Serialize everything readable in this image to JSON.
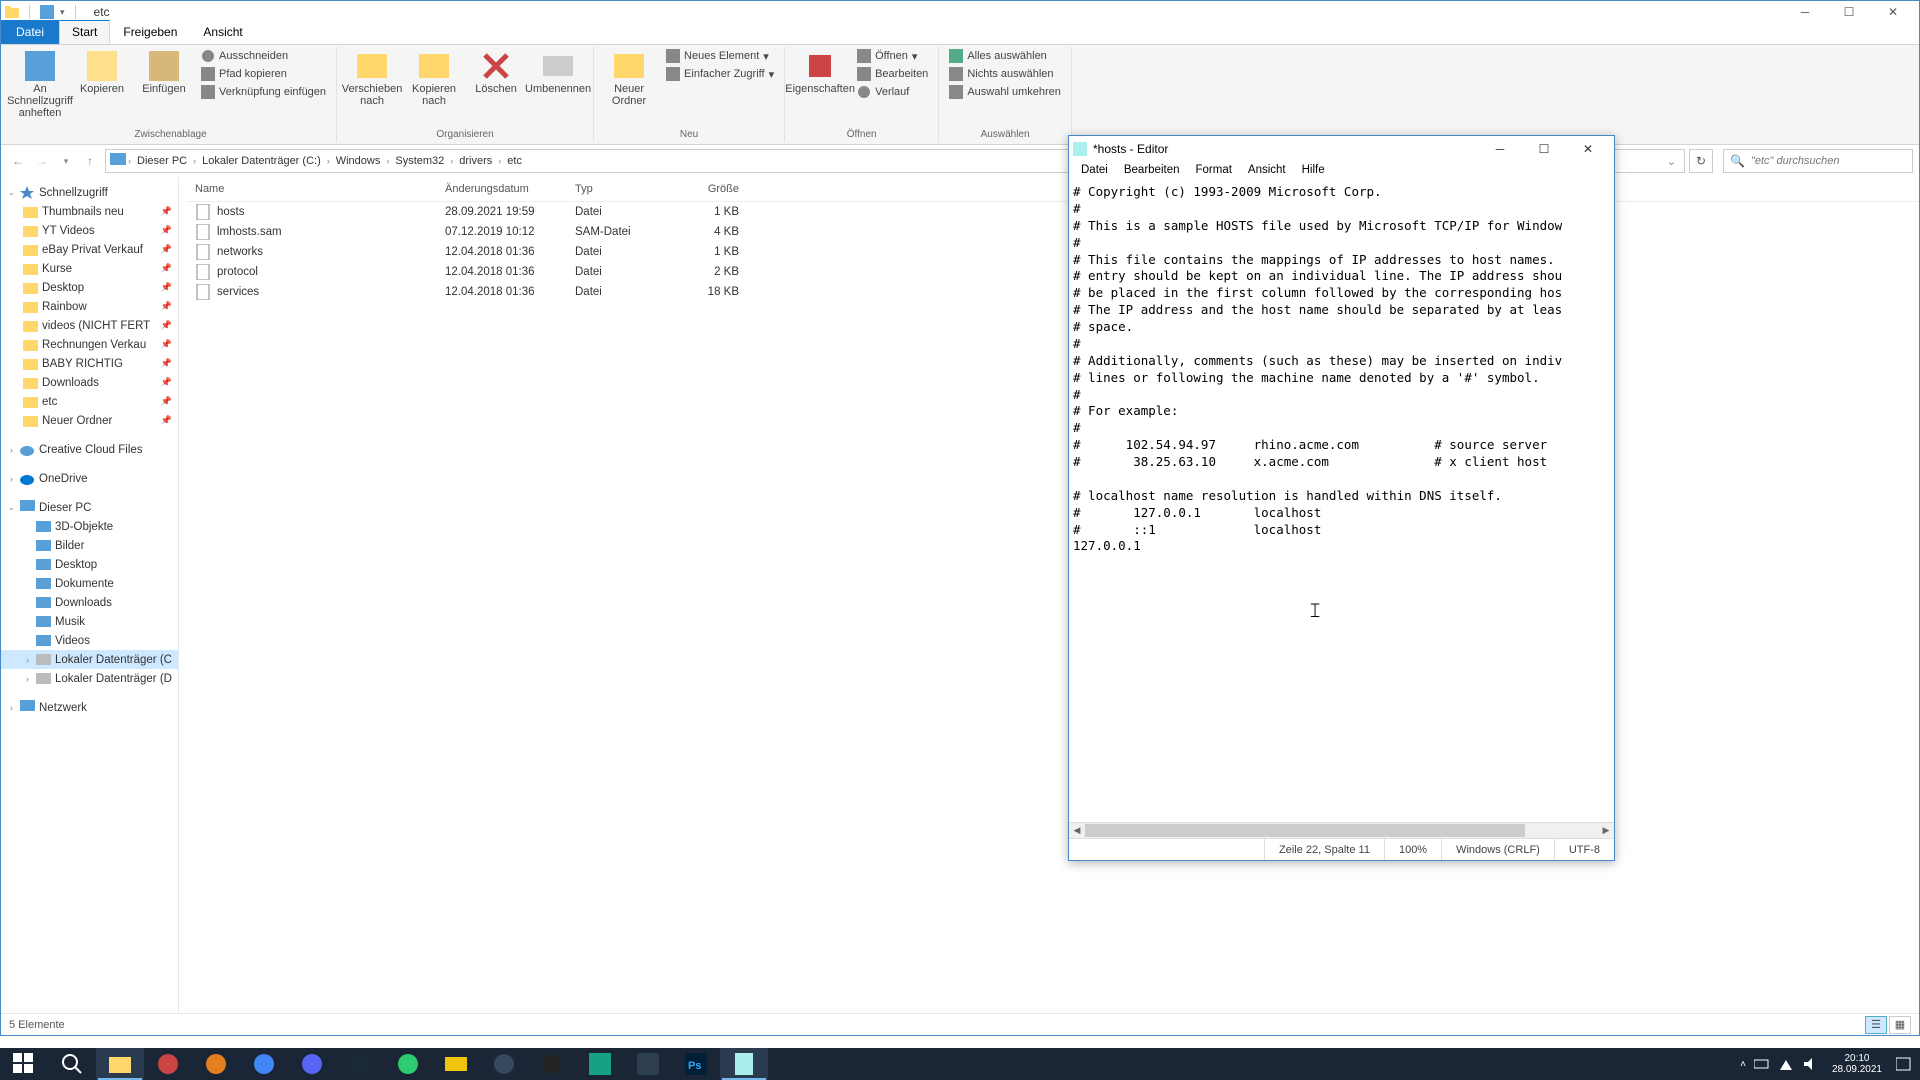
{
  "explorer": {
    "title": "etc",
    "tabs": {
      "file": "Datei",
      "start": "Start",
      "share": "Freigeben",
      "view": "Ansicht"
    },
    "ribbon": {
      "pin": "An Schnellzugriff anheften",
      "copy": "Kopieren",
      "paste": "Einfügen",
      "cut": "Ausschneiden",
      "copypath": "Pfad kopieren",
      "pastelink": "Verknüpfung einfügen",
      "clipboard_grp": "Zwischenablage",
      "moveto": "Verschieben nach",
      "copyto": "Kopieren nach",
      "delete": "Löschen",
      "rename": "Umbenennen",
      "organize_grp": "Organisieren",
      "newfolder": "Neuer Ordner",
      "newitem": "Neues Element",
      "easyaccess": "Einfacher Zugriff",
      "new_grp": "Neu",
      "properties": "Eigenschaften",
      "open": "Öffnen",
      "edit": "Bearbeiten",
      "history": "Verlauf",
      "open_grp": "Öffnen",
      "selectall": "Alles auswählen",
      "selectnone": "Nichts auswählen",
      "selectinv": "Auswahl umkehren",
      "select_grp": "Auswählen"
    },
    "breadcrumbs": [
      "Dieser PC",
      "Lokaler Datenträger (C:)",
      "Windows",
      "System32",
      "drivers",
      "etc"
    ],
    "search_ph": "\"etc\" durchsuchen",
    "tree": {
      "quick": "Schnellzugriff",
      "quick_items": [
        "Thumbnails neu",
        "YT Videos",
        "eBay Privat Verkauf",
        "Kurse",
        "Desktop",
        "Rainbow",
        "videos (NICHT FERT",
        "Rechnungen Verkau",
        "BABY RICHTIG",
        "Downloads",
        "etc",
        "Neuer Ordner"
      ],
      "creative": "Creative Cloud Files",
      "onedrive": "OneDrive",
      "thispc": "Dieser PC",
      "pc_items": [
        "3D-Objekte",
        "Bilder",
        "Desktop",
        "Dokumente",
        "Downloads",
        "Musik",
        "Videos",
        "Lokaler Datenträger (C",
        "Lokaler Datenträger (D"
      ],
      "network": "Netzwerk"
    },
    "columns": {
      "name": "Name",
      "date": "Änderungsdatum",
      "type": "Typ",
      "size": "Größe"
    },
    "files": [
      {
        "name": "hosts",
        "date": "28.09.2021 19:59",
        "type": "Datei",
        "size": "1 KB"
      },
      {
        "name": "lmhosts.sam",
        "date": "07.12.2019 10:12",
        "type": "SAM-Datei",
        "size": "4 KB"
      },
      {
        "name": "networks",
        "date": "12.04.2018 01:36",
        "type": "Datei",
        "size": "1 KB"
      },
      {
        "name": "protocol",
        "date": "12.04.2018 01:36",
        "type": "Datei",
        "size": "2 KB"
      },
      {
        "name": "services",
        "date": "12.04.2018 01:36",
        "type": "Datei",
        "size": "18 KB"
      }
    ],
    "status": "5 Elemente"
  },
  "notepad": {
    "title": "*hosts - Editor",
    "menu": [
      "Datei",
      "Bearbeiten",
      "Format",
      "Ansicht",
      "Hilfe"
    ],
    "text": "# Copyright (c) 1993-2009 Microsoft Corp.\n#\n# This is a sample HOSTS file used by Microsoft TCP/IP for Window\n#\n# This file contains the mappings of IP addresses to host names. \n# entry should be kept on an individual line. The IP address shou\n# be placed in the first column followed by the corresponding hos\n# The IP address and the host name should be separated by at leas\n# space.\n#\n# Additionally, comments (such as these) may be inserted on indiv\n# lines or following the machine name denoted by a '#' symbol.\n#\n# For example:\n#\n#      102.54.94.97     rhino.acme.com          # source server\n#       38.25.63.10     x.acme.com              # x client host\n\n# localhost name resolution is handled within DNS itself.\n#       127.0.0.1       localhost\n#       ::1             localhost\n127.0.0.1 ",
    "status": {
      "pos": "Zeile 22, Spalte 11",
      "zoom": "100%",
      "eol": "Windows (CRLF)",
      "enc": "UTF-8"
    }
  },
  "taskbar": {
    "time": "20:10",
    "date": "28.09.2021"
  }
}
